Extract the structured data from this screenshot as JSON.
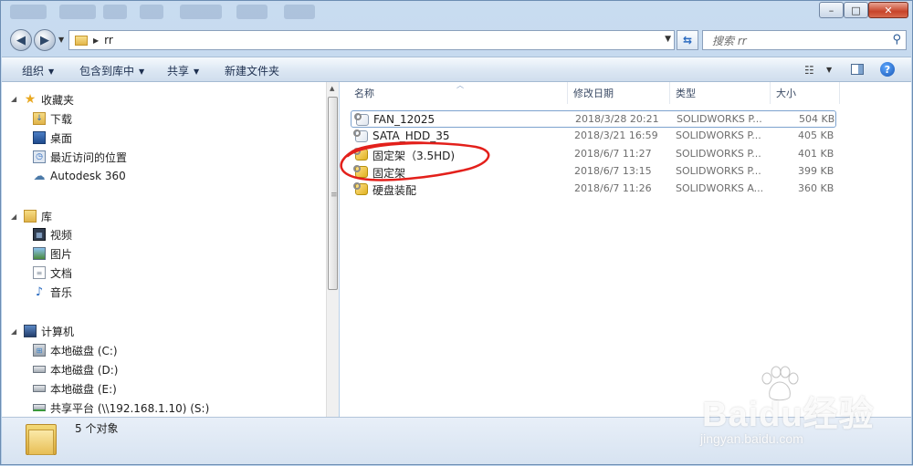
{
  "window": {
    "caption_buttons": [
      "–",
      "□",
      "✕"
    ]
  },
  "address_bar": {
    "path": "rr"
  },
  "search": {
    "placeholder": "搜索 rr"
  },
  "toolbar": {
    "organize": "组织",
    "include_in_library": "包含到库中",
    "share": "共享",
    "new_folder": "新建文件夹"
  },
  "nav": {
    "favorites": {
      "header": "收藏夹",
      "items": [
        "下载",
        "桌面",
        "最近访问的位置",
        "Autodesk 360"
      ]
    },
    "libraries": {
      "header": "库",
      "items": [
        "视频",
        "图片",
        "文档",
        "音乐"
      ]
    },
    "computer": {
      "header": "计算机",
      "items": [
        "本地磁盘 (C:)",
        "本地磁盘 (D:)",
        "本地磁盘 (E:)",
        "共享平台 (\\\\192.168.1.10) (S:)"
      ]
    }
  },
  "columns": {
    "name": "名称",
    "modified": "修改日期",
    "type": "类型",
    "size": "大小"
  },
  "files": [
    {
      "name": "FAN_12025",
      "modified": "2018/3/28 20:21",
      "type": "SOLIDWORKS P...",
      "size": "504 KB"
    },
    {
      "name": "SATA_HDD_35",
      "modified": "2018/3/21 16:59",
      "type": "SOLIDWORKS P...",
      "size": "405 KB"
    },
    {
      "name": "固定架（3.5HD)",
      "modified": "2018/6/7 11:27",
      "type": "SOLIDWORKS P...",
      "size": "401 KB"
    },
    {
      "name": "固定架",
      "modified": "2018/6/7 13:15",
      "type": "SOLIDWORKS P...",
      "size": "399 KB"
    },
    {
      "name": "硬盘装配",
      "modified": "2018/6/7 11:26",
      "type": "SOLIDWORKS A...",
      "size": "360 KB"
    }
  ],
  "status": {
    "count": "5 个对象"
  },
  "watermark": {
    "brand": "Baidu经验",
    "url": "jingyan.baidu.com"
  },
  "colors": {
    "accent": "#2a6ac0",
    "annotation_red": "#e3201b",
    "selection_border": "#7da2ce"
  }
}
